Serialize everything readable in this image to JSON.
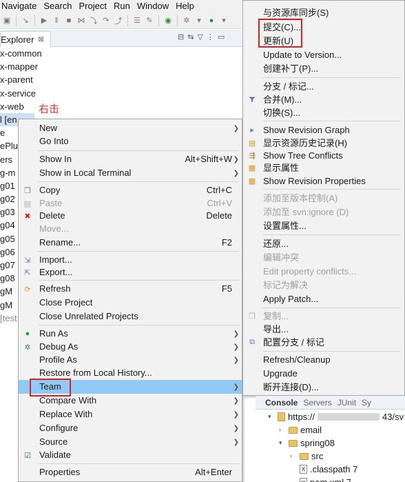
{
  "menubar": [
    "Navigate",
    "Search",
    "Project",
    "Run",
    "Window",
    "Help"
  ],
  "explorer": {
    "tab_label": "Explorer",
    "tree": [
      "x-common",
      "x-mapper",
      "x-parent",
      "x-service",
      "x-web",
      "l [en",
      "e",
      "ePlu",
      "ers",
      "g-m",
      "g01",
      "g02",
      "g03",
      "g04",
      "g05",
      "g06",
      "g07",
      "g08",
      "gM",
      "gM",
      "[test"
    ]
  },
  "annotation": "右击",
  "context_menu": [
    {
      "label": "New",
      "submenu": true,
      "icon": ""
    },
    {
      "label": "Go Into",
      "icon": ""
    },
    {
      "label": "Show In",
      "shortcut": "Alt+Shift+W",
      "submenu": true,
      "icon": ""
    },
    {
      "label": "Show in Local Terminal",
      "submenu": true,
      "icon": ""
    },
    {
      "label": "Copy",
      "shortcut": "Ctrl+C",
      "icon": "copy-icon"
    },
    {
      "label": "Paste",
      "shortcut": "Ctrl+V",
      "disabled": true,
      "icon": "paste-icon"
    },
    {
      "label": "Delete",
      "shortcut": "Delete",
      "icon": "delete-icon"
    },
    {
      "label": "Move...",
      "disabled": true,
      "icon": ""
    },
    {
      "label": "Rename...",
      "shortcut": "F2",
      "icon": ""
    },
    {
      "label": "Import...",
      "icon": "import-icon"
    },
    {
      "label": "Export...",
      "icon": "export-icon"
    },
    {
      "label": "Refresh",
      "shortcut": "F5",
      "icon": "refresh-icon"
    },
    {
      "label": "Close Project",
      "icon": ""
    },
    {
      "label": "Close Unrelated Projects",
      "icon": ""
    },
    {
      "label": "Run As",
      "submenu": true,
      "icon": "run-icon"
    },
    {
      "label": "Debug As",
      "submenu": true,
      "icon": "debug-icon"
    },
    {
      "label": "Profile As",
      "submenu": true,
      "icon": ""
    },
    {
      "label": "Restore from Local History...",
      "icon": ""
    },
    {
      "label": "Team",
      "submenu": true,
      "highlighted": true,
      "icon": ""
    },
    {
      "label": "Compare With",
      "submenu": true,
      "icon": ""
    },
    {
      "label": "Replace With",
      "submenu": true,
      "icon": ""
    },
    {
      "label": "Configure",
      "submenu": true,
      "icon": ""
    },
    {
      "label": "Source",
      "submenu": true,
      "icon": ""
    },
    {
      "label": "Validate",
      "icon": "validate-check-icon"
    },
    {
      "label": "Properties",
      "shortcut": "Alt+Enter",
      "icon": ""
    }
  ],
  "team_submenu": [
    {
      "label": "与资源库同步(S)",
      "icon": ""
    },
    {
      "label": "提交(C)...",
      "icon": ""
    },
    {
      "label": "更新(U)",
      "icon": ""
    },
    {
      "label": "Update to Version...",
      "icon": ""
    },
    {
      "label": "创建补丁(P)...",
      "icon": ""
    },
    {
      "label": "分支 / 标记...",
      "icon": ""
    },
    {
      "label": "合并(M)...",
      "icon": "merge-icon"
    },
    {
      "label": "切换(S)...",
      "icon": ""
    },
    {
      "label": "Show Revision Graph",
      "icon": "revision-graph-icon"
    },
    {
      "label": "显示资源历史记录(H)",
      "icon": "history-icon"
    },
    {
      "label": "Show Tree Conflicts",
      "icon": "tree-conflicts-icon"
    },
    {
      "label": "显示属性",
      "icon": "properties-icon"
    },
    {
      "label": "Show Revision Properties",
      "icon": "revision-properties-icon"
    },
    {
      "label": "添加至版本控制(A)",
      "disabled": true,
      "icon": ""
    },
    {
      "label": "添加至 svn:ignore (D)",
      "disabled": true,
      "icon": ""
    },
    {
      "label": "设置属性...",
      "icon": ""
    },
    {
      "label": "还原...",
      "icon": ""
    },
    {
      "label": "编辑冲突",
      "disabled": true,
      "icon": ""
    },
    {
      "label": "Edit property conflicts...",
      "disabled": true,
      "icon": ""
    },
    {
      "label": "标记为解决",
      "disabled": true,
      "icon": ""
    },
    {
      "label": "Apply Patch...",
      "icon": ""
    },
    {
      "label": "复制...",
      "disabled": true,
      "icon": "copy-icon"
    },
    {
      "label": "导出...",
      "icon": ""
    },
    {
      "label": "配置分支 / 标记",
      "icon": "configure-branches-icon"
    },
    {
      "label": "Refresh/Cleanup",
      "icon": ""
    },
    {
      "label": "Upgrade",
      "icon": ""
    },
    {
      "label": "断开连接(D)...",
      "icon": ""
    }
  ],
  "bottom_panel": {
    "tabs": [
      "Console",
      "Servers",
      "JUnit",
      "Sy"
    ],
    "rows": [
      "https://",
      "43/sv",
      "email",
      "spring08",
      "src",
      ".classpath 7",
      "pom.xml 7"
    ]
  },
  "colors": {
    "highlight": "#91c9f7",
    "redbox": "#e02020",
    "annotation": "#e03030"
  }
}
